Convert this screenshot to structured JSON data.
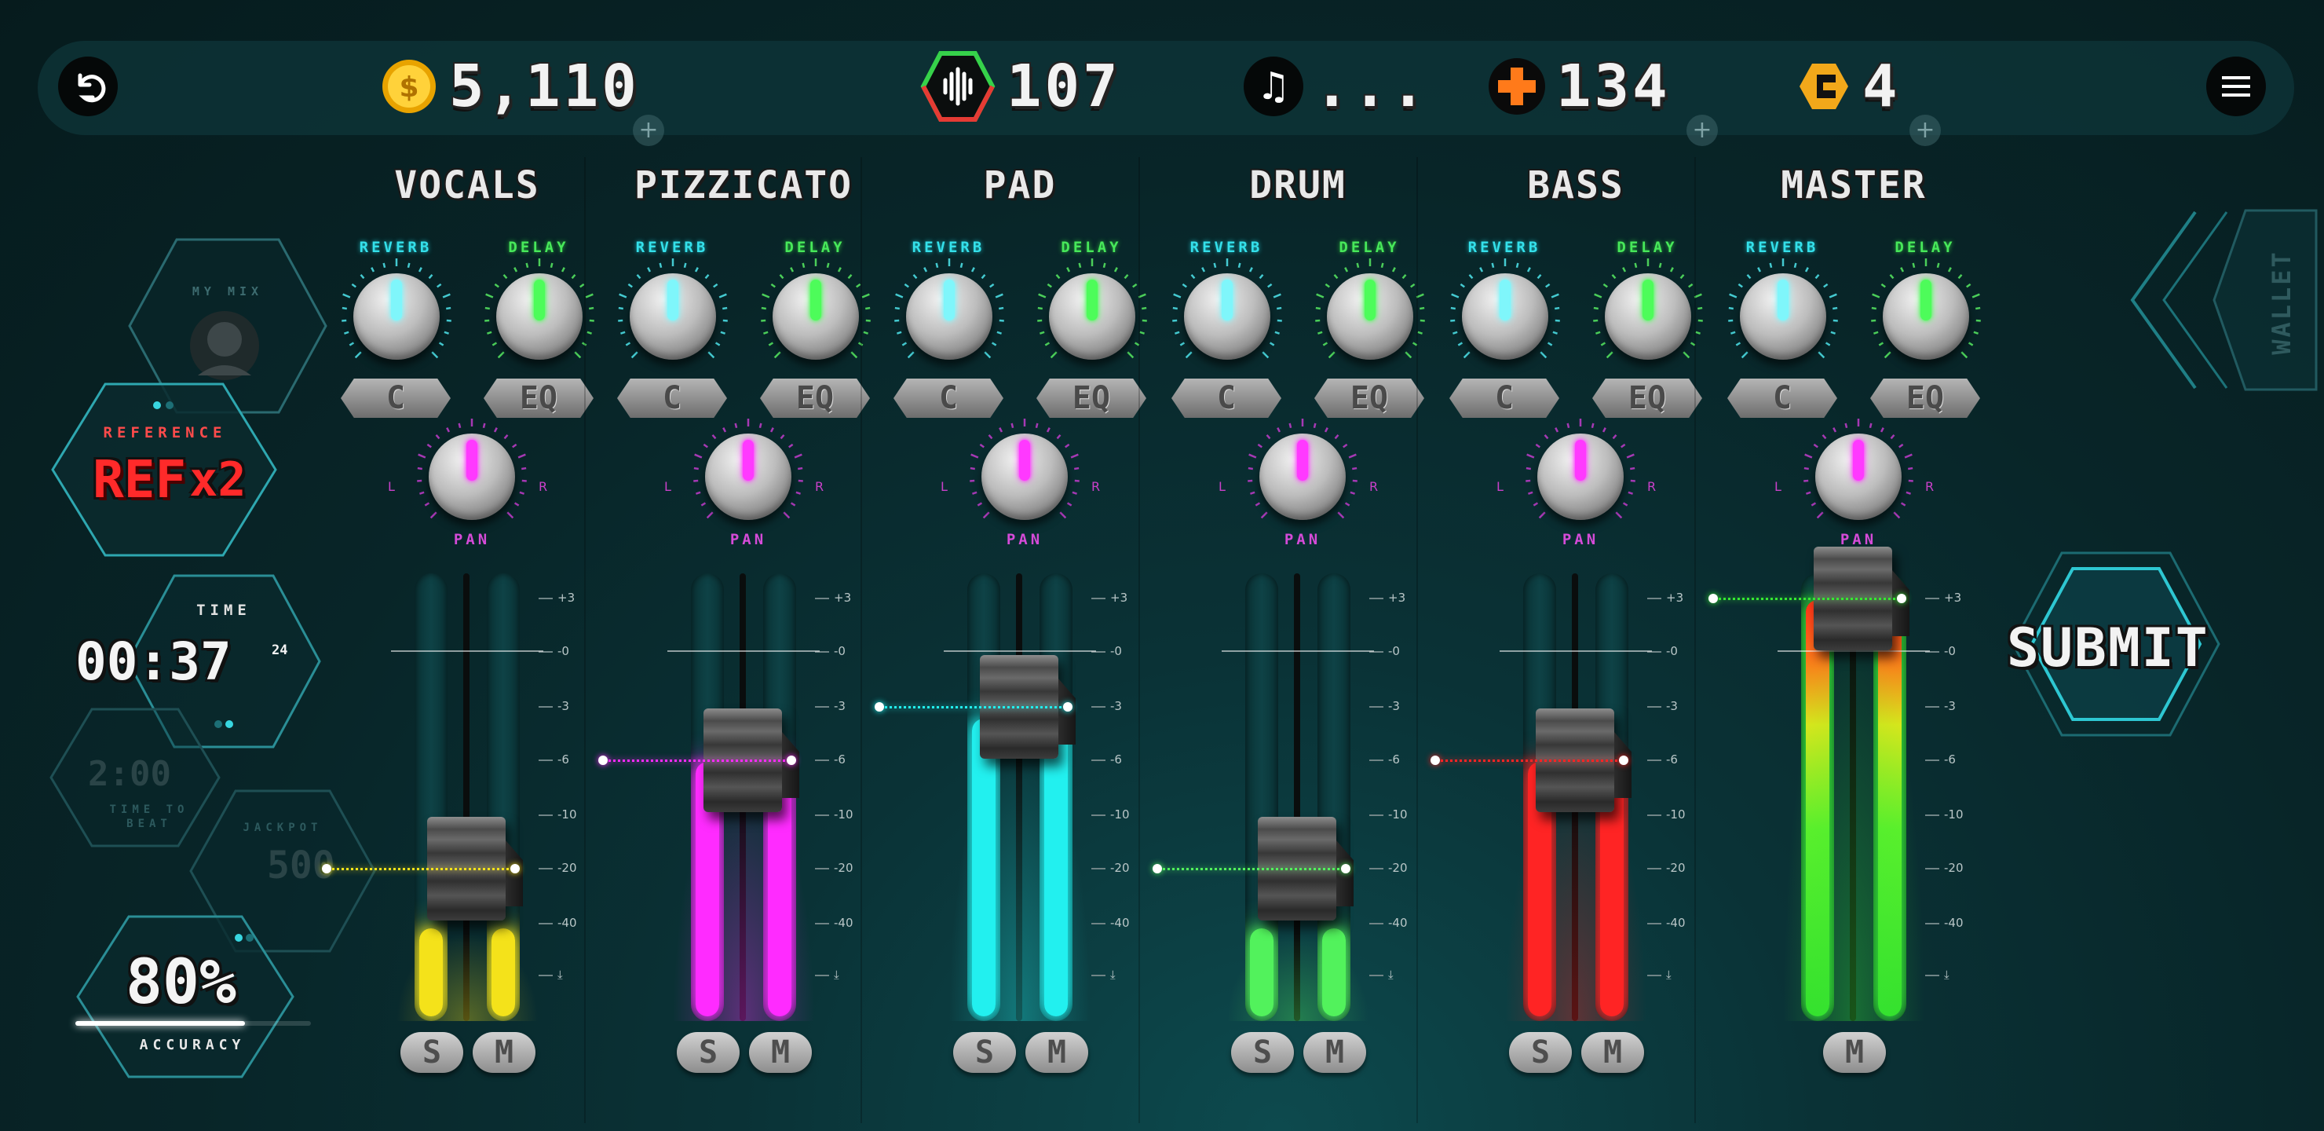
{
  "topbar": {
    "coins": "5,110",
    "samples": "107",
    "music": "...",
    "health": "134",
    "tokens": "4",
    "plus_glyph": "+"
  },
  "hud": {
    "my_mix_label": "MY MIX",
    "reference_label": "REFERENCE",
    "ref_text": "REF",
    "ref_multiplier": "x2",
    "time_label": "TIME",
    "time_value": "00:37",
    "time_ms": "24",
    "time_to_beat_value": "2:00",
    "time_to_beat_label": "TIME TO BEAT",
    "jackpot_label": "JACKPOT",
    "jackpot_value": "500",
    "accuracy_value": "80%",
    "accuracy_label": "ACCURACY",
    "accuracy_progress": 0.72
  },
  "labels": {
    "reverb": "REVERB",
    "delay": "DELAY",
    "comp": "C",
    "eq": "EQ",
    "pan": "PAN",
    "left": "L",
    "right": "R",
    "solo": "S",
    "mute": "M"
  },
  "scale": [
    "+3",
    "-0",
    "-3",
    "-6",
    "-10",
    "-20",
    "-40",
    "⤓"
  ],
  "channels": [
    {
      "name": "VOCALS",
      "color": "#f4e21a",
      "fader_db": "-20",
      "meter": 0.2,
      "has_solo": true
    },
    {
      "name": "PIZZICATO",
      "color": "#ff2bff",
      "fader_db": "-6",
      "meter": 0.58,
      "has_solo": true
    },
    {
      "name": "PAD",
      "color": "#22f0ef",
      "fader_db": "-3",
      "meter": 0.68,
      "has_solo": true
    },
    {
      "name": "DRUM",
      "color": "#52f25c",
      "fader_db": "-20",
      "meter": 0.2,
      "has_solo": true
    },
    {
      "name": "BASS",
      "color": "#ff2424",
      "fader_db": "-6",
      "meter": 0.58,
      "has_solo": true
    },
    {
      "name": "MASTER",
      "color": "#37e832",
      "fader_db": "+3",
      "meter": 0.95,
      "has_solo": false
    }
  ],
  "side": {
    "wallet_label": "WALLET",
    "submit_label": "SUBMIT"
  }
}
